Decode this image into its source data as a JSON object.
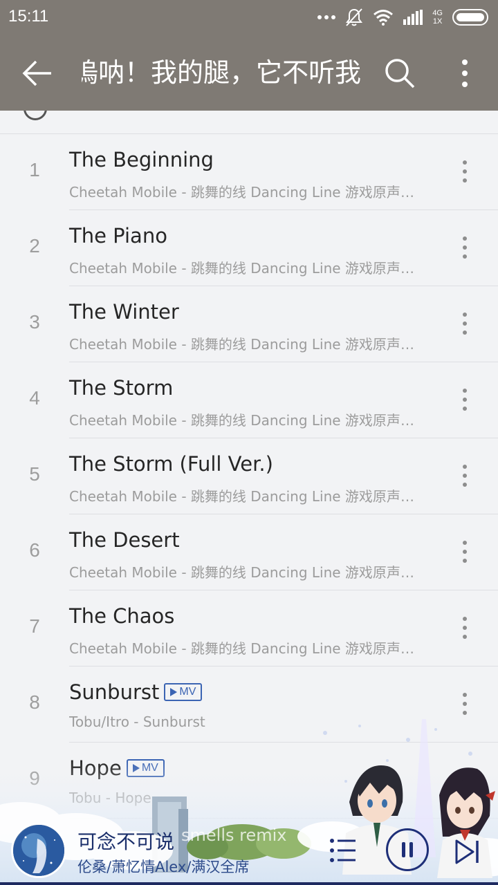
{
  "status_bar": {
    "time": "15:11",
    "network_top": "4G",
    "network_bottom": "1X"
  },
  "toolbar": {
    "title": "嗚呐！我的腿，它不听我的"
  },
  "tracks": [
    {
      "index": "1",
      "title": "The Beginning",
      "subtitle": "Cheetah Mobile - 跳舞的线 Dancing Line 游戏原声背景音乐",
      "mv": false
    },
    {
      "index": "2",
      "title": "The Piano",
      "subtitle": "Cheetah Mobile - 跳舞的线 Dancing Line 游戏原声背景音乐",
      "mv": false
    },
    {
      "index": "3",
      "title": "The Winter",
      "subtitle": "Cheetah Mobile - 跳舞的线 Dancing Line 游戏原声背景音乐",
      "mv": false
    },
    {
      "index": "4",
      "title": "The Storm",
      "subtitle": "Cheetah Mobile - 跳舞的线 Dancing Line 游戏原声背景音乐",
      "mv": false
    },
    {
      "index": "5",
      "title": "The Storm (Full Ver.)",
      "subtitle": "Cheetah Mobile - 跳舞的线 Dancing Line 游戏原声背景音乐",
      "mv": false
    },
    {
      "index": "6",
      "title": "The Desert",
      "subtitle": "Cheetah Mobile - 跳舞的线 Dancing Line 游戏原声背景音乐",
      "mv": false
    },
    {
      "index": "7",
      "title": "The Chaos",
      "subtitle": "Cheetah Mobile - 跳舞的线 Dancing Line 游戏原声背景音乐",
      "mv": false
    },
    {
      "index": "8",
      "title": "Sunburst",
      "subtitle": "Tobu/Itro - Sunburst",
      "mv": true
    },
    {
      "index": "9",
      "title": "Hope",
      "subtitle": "Tobu - Hope",
      "mv": true
    }
  ],
  "mv_badge_label": "MV",
  "now_playing": {
    "title": "可念不可说",
    "artist": "伦桑/萧忆情Alex/满汉全席",
    "next_partial_title": "smells remix"
  },
  "colors": {
    "header_bg": "#7f7a74",
    "accent": "#1e2f78",
    "mv_badge": "#3b64b3"
  },
  "icons": {
    "back": "arrow-left-icon",
    "search": "search-icon",
    "more": "more-vertical-icon",
    "queue": "playlist-icon",
    "pause": "pause-icon",
    "next": "skip-next-icon"
  }
}
